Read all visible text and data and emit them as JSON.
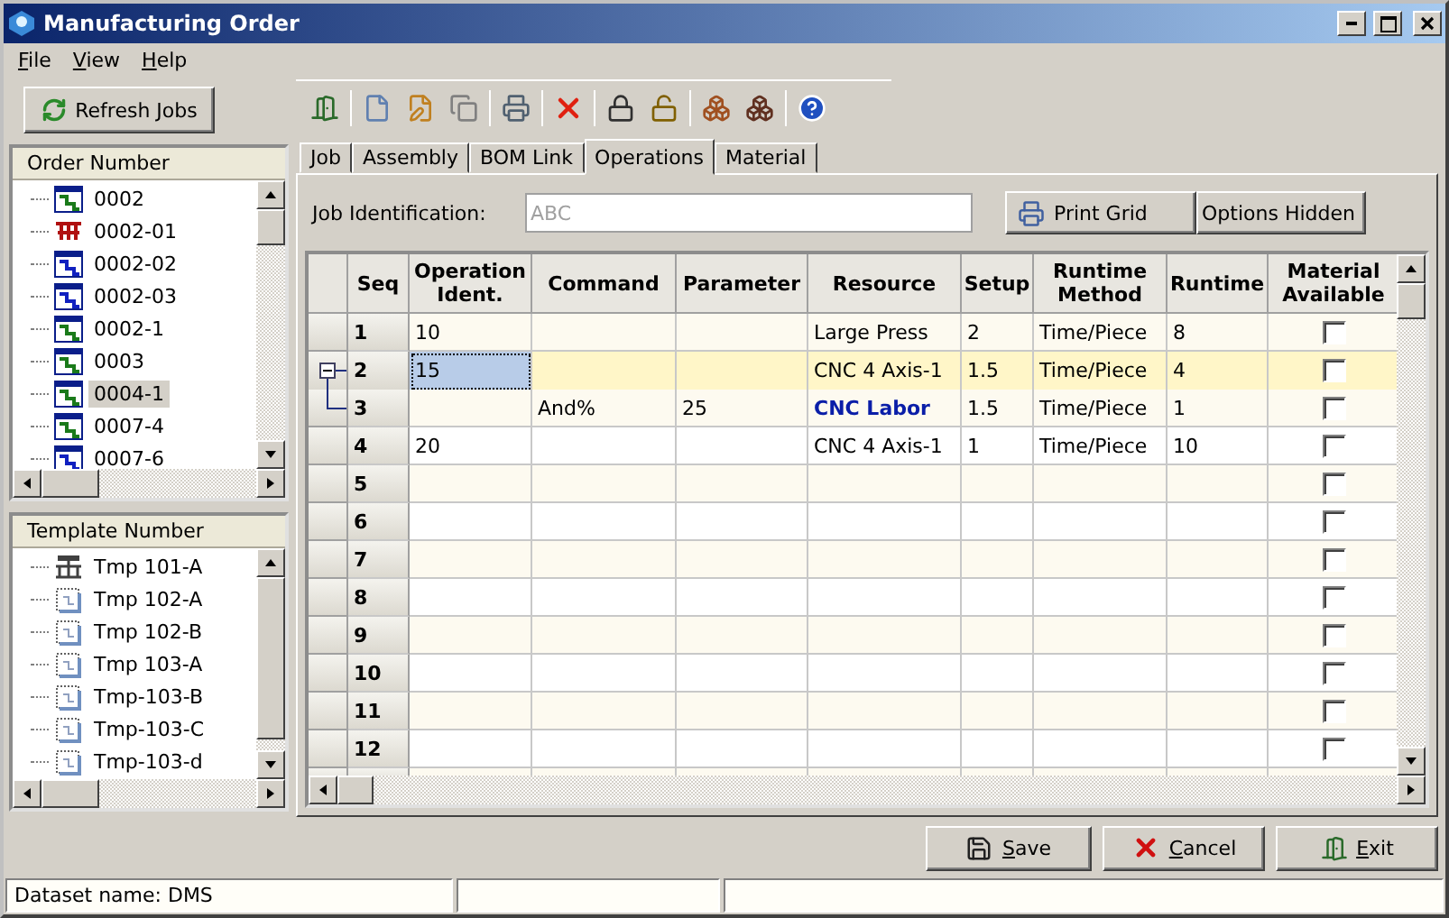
{
  "window": {
    "title": "Manufacturing Order"
  },
  "menu": [
    "File",
    "View",
    "Help"
  ],
  "refresh_button": "Refresh Jobs",
  "order_tree": {
    "header": "Order Number",
    "items": [
      {
        "label": "0002",
        "kind": "job",
        "color": "#1a7a1a",
        "selected": false
      },
      {
        "label": "0002-01",
        "kind": "assembly",
        "color": "#b01010",
        "selected": false
      },
      {
        "label": "0002-02",
        "kind": "job",
        "color": "#1020c0",
        "selected": false
      },
      {
        "label": "0002-03",
        "kind": "job",
        "color": "#1020c0",
        "selected": false
      },
      {
        "label": "0002-1",
        "kind": "job",
        "color": "#1a7a1a",
        "selected": false
      },
      {
        "label": "0003",
        "kind": "job",
        "color": "#1a7a1a",
        "selected": false
      },
      {
        "label": "0004-1",
        "kind": "job",
        "color": "#1a7a1a",
        "selected": true
      },
      {
        "label": "0007-4",
        "kind": "job",
        "color": "#1a7a1a",
        "selected": false
      },
      {
        "label": "0007-6",
        "kind": "job",
        "color": "#1020c0",
        "selected": false
      }
    ]
  },
  "template_tree": {
    "header": "Template Number",
    "items": [
      {
        "label": "Tmp 101-A",
        "kind": "machine"
      },
      {
        "label": "Tmp 102-A",
        "kind": "template"
      },
      {
        "label": "Tmp 102-B",
        "kind": "template"
      },
      {
        "label": "Tmp 103-A",
        "kind": "template"
      },
      {
        "label": "Tmp-103-B",
        "kind": "template"
      },
      {
        "label": "Tmp-103-C",
        "kind": "template"
      },
      {
        "label": "Tmp-103-d",
        "kind": "template"
      }
    ]
  },
  "tabs": [
    {
      "label": "Job",
      "selected": false
    },
    {
      "label": "Assembly",
      "selected": false
    },
    {
      "label": "BOM Link",
      "selected": false
    },
    {
      "label": "Operations",
      "selected": true
    },
    {
      "label": "Material",
      "selected": false
    }
  ],
  "job_identification": {
    "label": "Job Identification:",
    "placeholder": "ABC"
  },
  "print_grid_button": "Print Grid",
  "options_button": "Options Hidden",
  "grid": {
    "columns": [
      "Seq",
      "Operation Ident.",
      "Command",
      "Parameter",
      "Resource",
      "Setup",
      "Runtime Method",
      "Runtime",
      "Material Available"
    ],
    "rows": [
      {
        "seq": "1",
        "op": "10",
        "resource": "Large Press",
        "setup": "2",
        "method": "Time/Piece",
        "runtime": "8",
        "resource_highlighted": false,
        "selected": false,
        "material_available": false
      },
      {
        "seq": "2",
        "op": "15",
        "resource": "CNC 4 Axis-1",
        "setup": "1.5",
        "method": "Time/Piece",
        "runtime": "4",
        "resource_highlighted": false,
        "selected": true,
        "material_available": false,
        "expanded": true,
        "children": [
          {
            "seq": "3",
            "command": "And%",
            "parameter": "25",
            "resource": "CNC Labor",
            "setup": "1.5",
            "method": "Time/Piece",
            "runtime": "1",
            "resource_highlighted": true,
            "selected": false,
            "material_available": false
          }
        ]
      },
      {
        "seq": "4",
        "op": "20",
        "resource": "CNC 4 Axis-1",
        "setup": "1",
        "method": "Time/Piece",
        "runtime": "10",
        "resource_highlighted": false,
        "selected": false,
        "material_available": false
      },
      {
        "seq": "5",
        "selected": false,
        "material_available": false
      },
      {
        "seq": "6",
        "selected": false,
        "material_available": false
      },
      {
        "seq": "7",
        "selected": false,
        "material_available": false
      },
      {
        "seq": "8",
        "selected": false,
        "material_available": false
      },
      {
        "seq": "9",
        "selected": false,
        "material_available": false
      },
      {
        "seq": "10",
        "selected": false,
        "material_available": false
      },
      {
        "seq": "11",
        "selected": false,
        "material_available": false
      },
      {
        "seq": "12",
        "selected": false,
        "material_available": false
      }
    ]
  },
  "buttons": [
    "Save",
    "Cancel",
    "Exit"
  ],
  "status_bar": [
    "Dataset name:  DMS"
  ]
}
